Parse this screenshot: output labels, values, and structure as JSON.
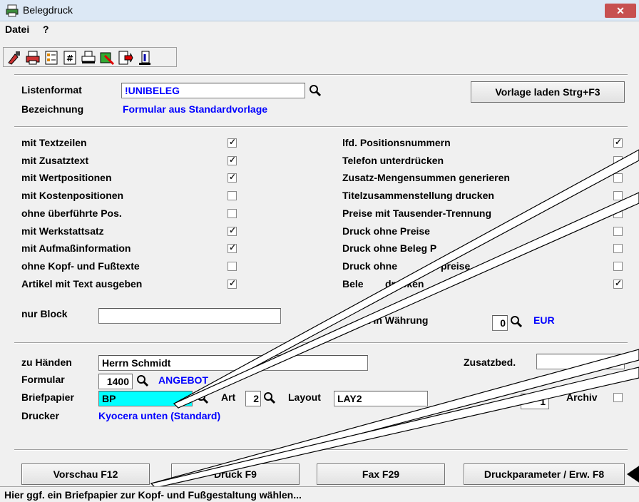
{
  "window": {
    "title": "Belegdruck",
    "close": "✕"
  },
  "menu": {
    "datei": "Datei",
    "help": "?"
  },
  "top": {
    "listenformat_label": "Listenformat",
    "listenformat_value": "!UNIBELEG",
    "bezeichnung_label": "Bezeichnung",
    "bezeichnung_value": "Formular aus Standardvorlage",
    "vorlage_button": "Vorlage laden Strg+F3"
  },
  "options_left": [
    {
      "label": "mit Textzeilen",
      "checked": true
    },
    {
      "label": "mit Zusatztext",
      "checked": true
    },
    {
      "label": "mit Wertpositionen",
      "checked": true
    },
    {
      "label": "mit Kostenpositionen",
      "checked": false
    },
    {
      "label": "ohne überführte Pos.",
      "checked": false
    },
    {
      "label": "mit Werkstattsatz",
      "checked": true
    },
    {
      "label": "mit Aufmaßinformation",
      "checked": true
    },
    {
      "label": "ohne Kopf- und Fußtexte",
      "checked": false
    },
    {
      "label": "Artikel mit Text ausgeben",
      "checked": true
    }
  ],
  "nur_block_label": "nur Block",
  "options_right": [
    {
      "label": "lfd. Positionsnummern",
      "checked": true
    },
    {
      "label": "Telefon unterdrücken",
      "checked": false
    },
    {
      "label": "Zusatz-Mengensummen generieren",
      "checked": false
    },
    {
      "label": "Titelzusammenstellung drucken",
      "checked": false
    },
    {
      "label": "Preise mit Tausender-Trennung",
      "checked": false
    },
    {
      "label": "Druck ohne Preise",
      "checked": false
    },
    {
      "label": "Druck ohne Beleg P",
      "checked": false
    },
    {
      "label": "Druck ohne ",
      "label2": "preise",
      "checked": false
    },
    {
      "label": "Bele",
      "label2": "drucken",
      "checked": true
    }
  ],
  "waehrung": {
    "label": "ck in Währung",
    "value": "0",
    "currency": "EUR"
  },
  "bottom": {
    "zu_haenden_label": "zu Händen",
    "zu_haenden_value": "Herrn Schmidt",
    "zusatzbed_label": "Zusatzbed.",
    "formular_label": "Formular",
    "formular_value": "1400",
    "formular_desc": "ANGEBOT",
    "briefpapier_label": "Briefpapier",
    "briefpapier_value": "BP",
    "art_label": "Art",
    "art_value": "2",
    "layout_label": "Layout",
    "layout_value": "LAY2",
    "copies_value": "1",
    "archiv_label": "Archiv",
    "drucker_label": "Drucker",
    "drucker_value": "Kyocera unten (Standard)"
  },
  "buttons": {
    "vorschau": "Vorschau F12",
    "druck": "Druck F9",
    "fax": "Fax F29",
    "druckparameter": "Druckparameter / Erw. F8"
  },
  "status": "Hier ggf. ein Briefpapier zur Kopf- und Fußgestaltung wählen...",
  "colors": {
    "highlight_input": "#00ffff",
    "blue_text": "#0000ff"
  }
}
